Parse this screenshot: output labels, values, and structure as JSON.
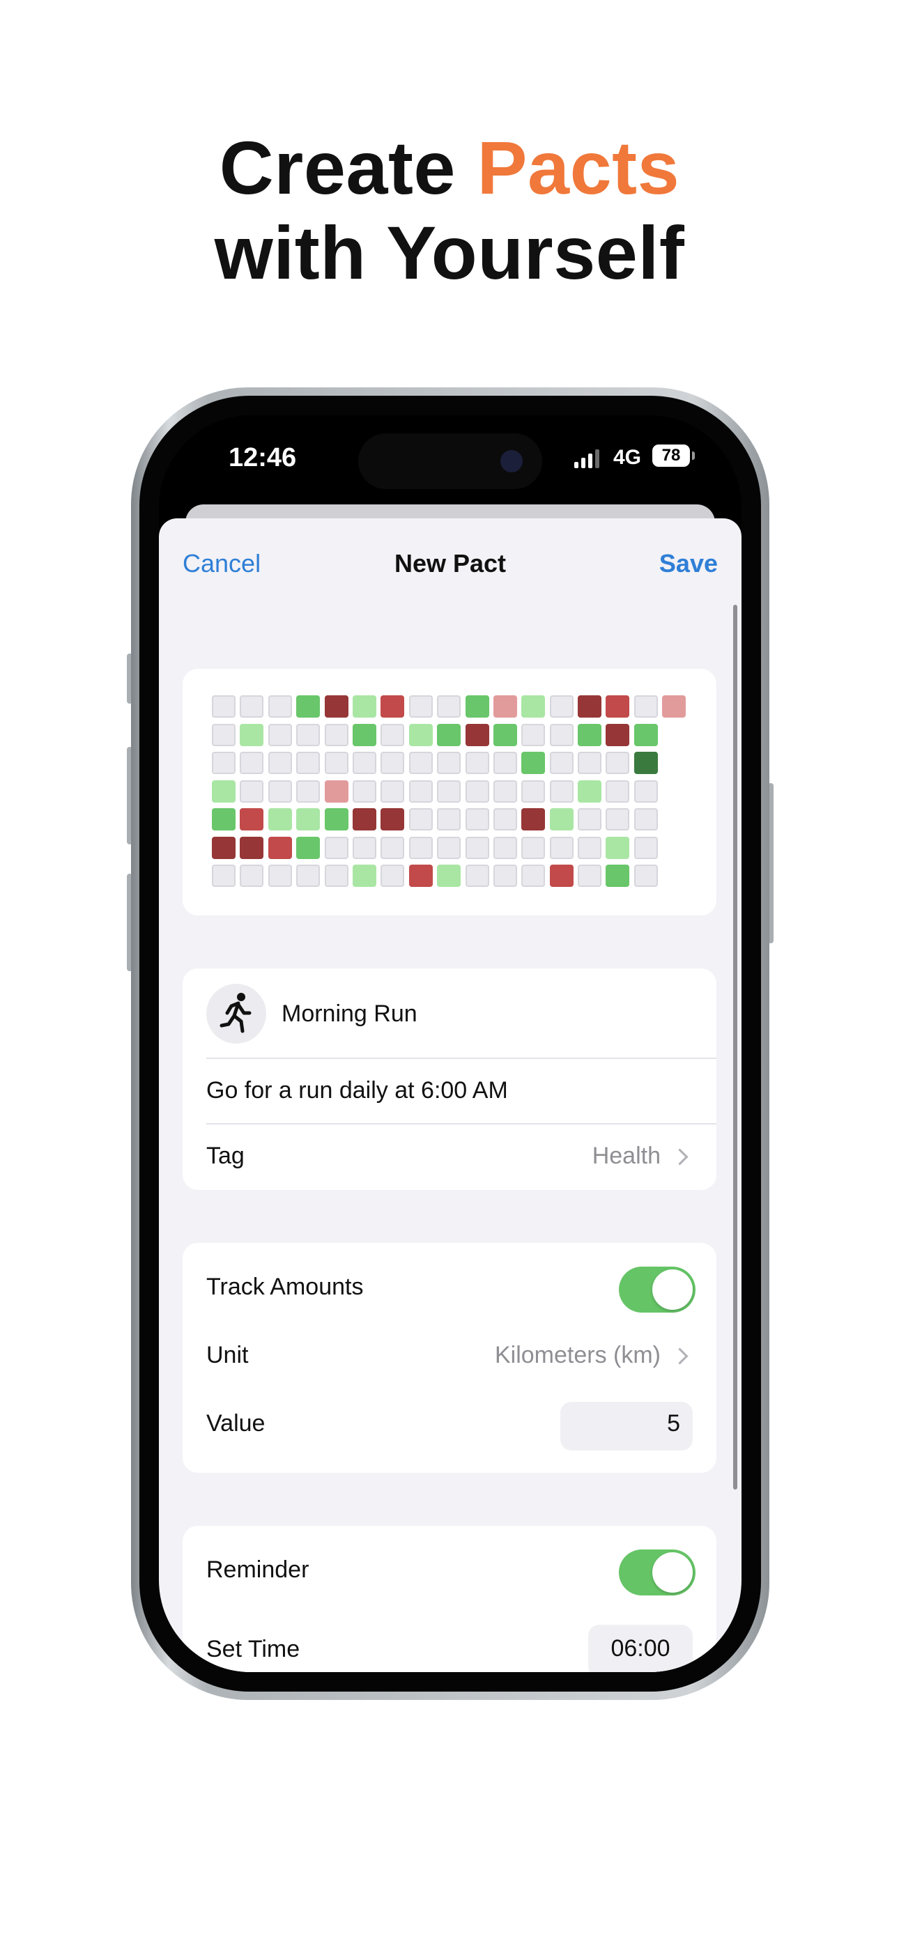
{
  "headline": {
    "line1_pre": "Create ",
    "line1_accent": "Pacts",
    "line2": "with Yourself"
  },
  "colors": {
    "accent": "#f0783a",
    "ios_blue": "#2f7fd6",
    "toggle_on": "#65c466"
  },
  "status_bar": {
    "time": "12:46",
    "network": "4G",
    "battery": "78"
  },
  "nav": {
    "cancel": "Cancel",
    "title": "New Pact",
    "save": "Save"
  },
  "heatmap": {
    "legend_levels": {
      "0": "empty",
      "1": "light-green",
      "2": "green",
      "3": "dark-green",
      "4": "light-red",
      "5": "red",
      "6": "dark-red"
    },
    "rows": [
      [
        0,
        0,
        0,
        2,
        6,
        1,
        5,
        0,
        0,
        2,
        4,
        1,
        0,
        6,
        5,
        0,
        4
      ],
      [
        0,
        1,
        0,
        0,
        0,
        2,
        0,
        1,
        2,
        6,
        2,
        0,
        0,
        2,
        6,
        2
      ],
      [
        0,
        0,
        0,
        0,
        0,
        0,
        0,
        0,
        0,
        0,
        0,
        2,
        0,
        0,
        0,
        3
      ],
      [
        1,
        0,
        0,
        0,
        4,
        0,
        0,
        0,
        0,
        0,
        0,
        0,
        0,
        1,
        0,
        0
      ],
      [
        2,
        5,
        1,
        1,
        2,
        6,
        6,
        0,
        0,
        0,
        0,
        6,
        1,
        0,
        0,
        0
      ],
      [
        6,
        6,
        5,
        2,
        0,
        0,
        0,
        0,
        0,
        0,
        0,
        0,
        0,
        0,
        1,
        0
      ],
      [
        0,
        0,
        0,
        0,
        0,
        1,
        0,
        5,
        1,
        0,
        0,
        0,
        5,
        0,
        2,
        0
      ]
    ]
  },
  "pact": {
    "icon": "running-person-icon",
    "name": "Morning Run",
    "description": "Go for a run daily at 6:00 AM",
    "tag_label": "Tag",
    "tag_value": "Health"
  },
  "tracking": {
    "track_label": "Track Amounts",
    "track_on": true,
    "unit_label": "Unit",
    "unit_value": "Kilometers (km)",
    "value_label": "Value",
    "value": "5"
  },
  "reminder": {
    "label": "Reminder",
    "on": true,
    "time_label": "Set Time",
    "time_value": "06:00"
  }
}
